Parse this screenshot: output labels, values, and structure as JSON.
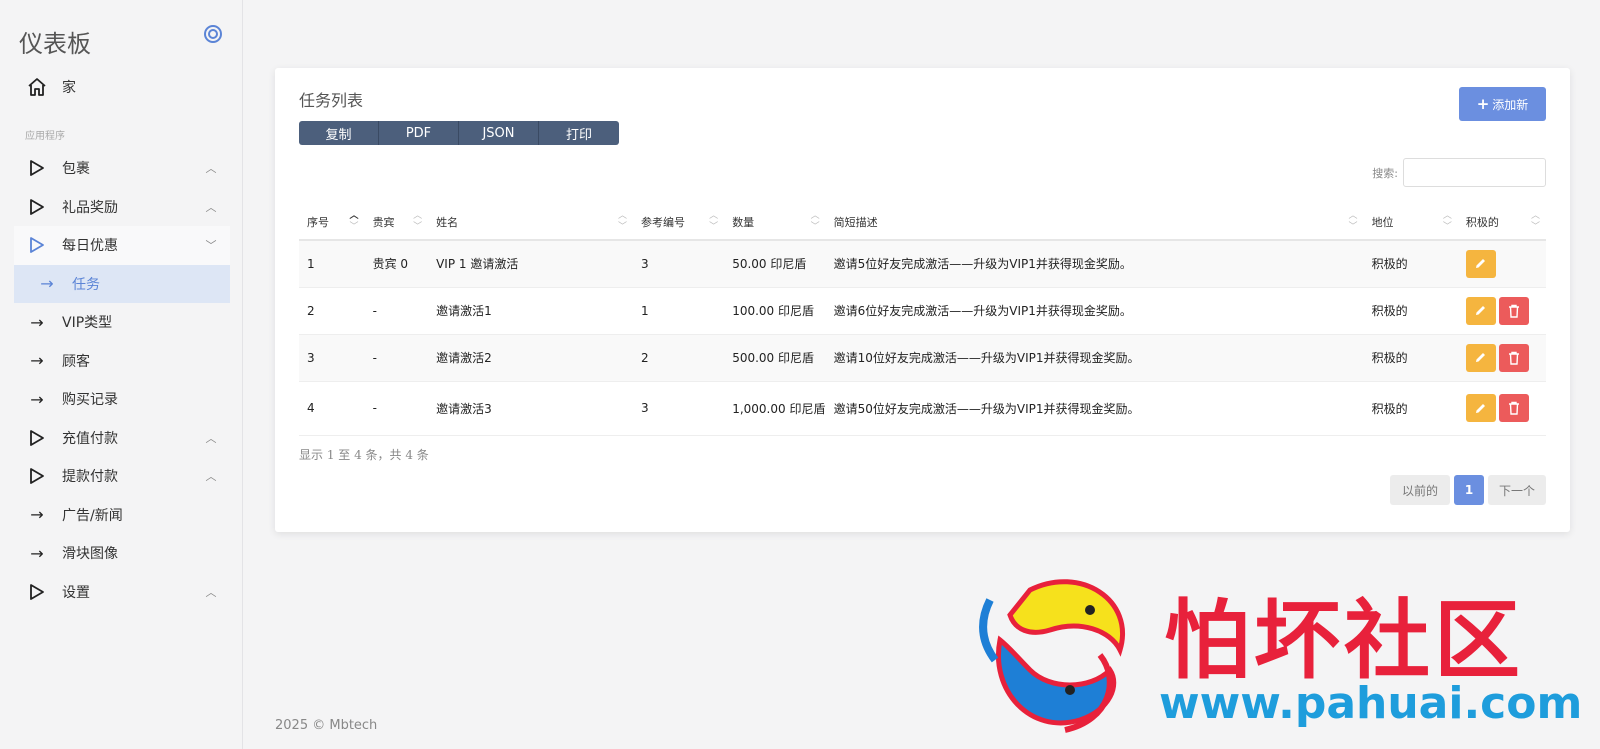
{
  "sidebar": {
    "brand": "仪表板",
    "home": "家",
    "section_label": "应用程序",
    "items": [
      {
        "label": "包裹",
        "icon": "play-icon",
        "chevron": "^"
      },
      {
        "label": "礼品奖励",
        "icon": "play-icon",
        "chevron": "^"
      },
      {
        "label": "每日优惠",
        "icon": "play-icon",
        "chevron": "v"
      },
      {
        "label": "任务",
        "icon": "arrow-right-icon",
        "chevron": ""
      },
      {
        "label": "VIP类型",
        "icon": "arrow-right-icon",
        "chevron": ""
      },
      {
        "label": "顾客",
        "icon": "arrow-right-icon",
        "chevron": ""
      },
      {
        "label": "购买记录",
        "icon": "arrow-right-icon",
        "chevron": ""
      },
      {
        "label": "充值付款",
        "icon": "play-icon",
        "chevron": "^"
      },
      {
        "label": "提款付款",
        "icon": "play-icon",
        "chevron": "^"
      },
      {
        "label": "广告/新闻",
        "icon": "arrow-right-icon",
        "chevron": ""
      },
      {
        "label": "滑块图像",
        "icon": "arrow-right-icon",
        "chevron": ""
      },
      {
        "label": "设置",
        "icon": "play-icon",
        "chevron": "^"
      }
    ]
  },
  "card": {
    "title": "任务列表",
    "add_button": "添加新",
    "export": [
      "复制",
      "PDF",
      "JSON",
      "打印"
    ],
    "search_label": "搜索:",
    "search_value": ""
  },
  "table": {
    "headers": [
      "序号",
      "贵宾",
      "姓名",
      "参考编号",
      "数量",
      "简短描述",
      "地位",
      "积极的"
    ],
    "rows": [
      {
        "no": "1",
        "vip": "贵宾 0",
        "name": "VIP 1 邀请激活",
        "ref": "3",
        "amount": "50.00 印尼盾",
        "desc": "邀请5位好友完成激活——升级为VIP1并获得现金奖励。",
        "status": "积极的",
        "deletable": false
      },
      {
        "no": "2",
        "vip": "-",
        "name": "邀请激活1",
        "ref": "1",
        "amount": "100.00 印尼盾",
        "desc": "邀请6位好友完成激活——升级为VIP1并获得现金奖励。",
        "status": "积极的",
        "deletable": true
      },
      {
        "no": "3",
        "vip": "-",
        "name": "邀请激活2",
        "ref": "2",
        "amount": "500.00 印尼盾",
        "desc": "邀请10位好友完成激活——升级为VIP1并获得现金奖励。",
        "status": "积极的",
        "deletable": true
      },
      {
        "no": "4",
        "vip": "-",
        "name": "邀请激活3",
        "ref": "3",
        "amount": "1,000.00 印尼盾",
        "desc": "邀请50位好友完成激活——升级为VIP1并获得现金奖励。",
        "status": "积极的",
        "deletable": true
      }
    ]
  },
  "info": "显示 1 至 4 条，共 4 条",
  "pager": {
    "prev": "以前的",
    "current": "1",
    "next": "下一个"
  },
  "footer": "2025 © Mbtech",
  "watermark": {
    "title": "怕坏社区",
    "url": "www.pahuai.com"
  },
  "colors": {
    "accent": "#6b8fe0",
    "edit": "#f5b53f",
    "delete": "#ec5b5b",
    "export": "#4c5f7c"
  }
}
